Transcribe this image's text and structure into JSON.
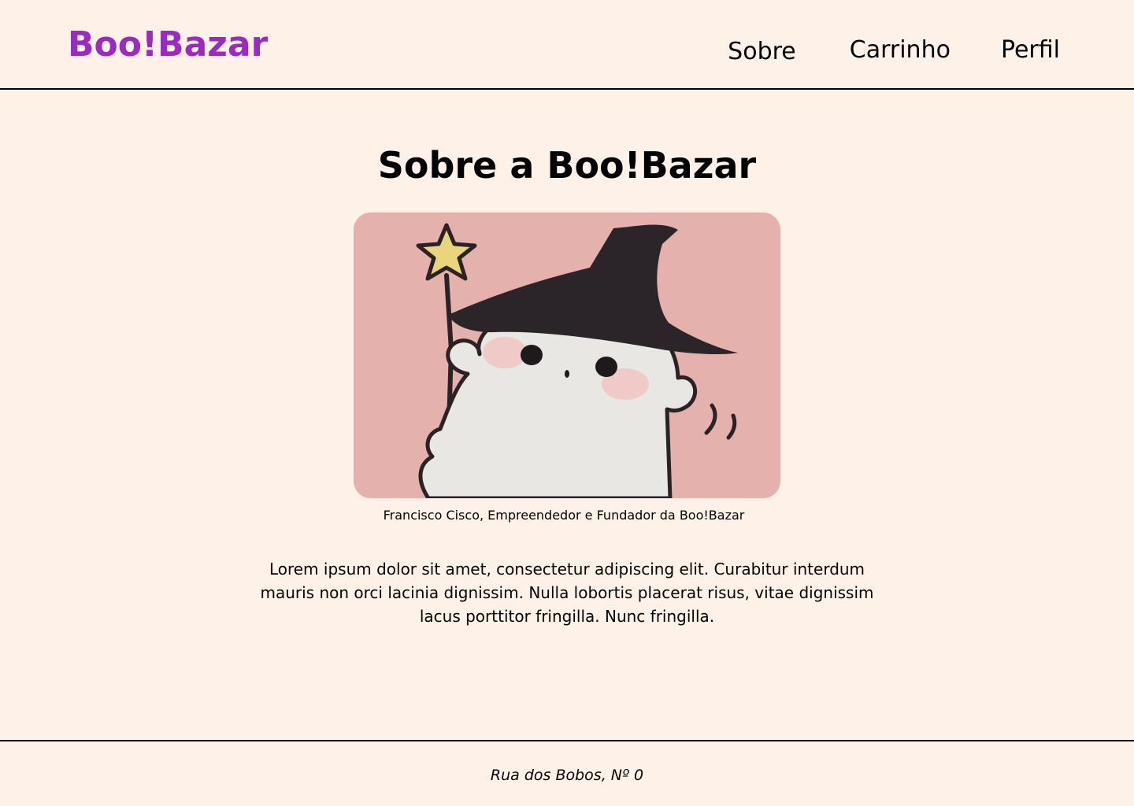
{
  "header": {
    "logo": "Boo!Bazar",
    "nav": [
      "Sobre",
      "Carrinho",
      "Perfil"
    ]
  },
  "main": {
    "title": "Sobre a Boo!Bazar",
    "image_caption": "Francisco Cisco, Empreendedor e Fundador da Boo!Bazar",
    "description": "Lorem ipsum dolor sit amet, consectetur adipiscing elit. Curabitur interdum mauris non orci lacinia dignissim. Nulla lobortis placerat risus, vitae dignissim lacus porttitor fringilla. Nunc fringilla."
  },
  "footer": {
    "address": "Rua dos Bobos, Nº 0"
  },
  "colors": {
    "background": "#fef2e8",
    "brand": "#9a2bc0",
    "text": "#000000",
    "photo_background": "#e4b1ac"
  },
  "icons": {
    "photo": "ghost-witch-illustration"
  }
}
